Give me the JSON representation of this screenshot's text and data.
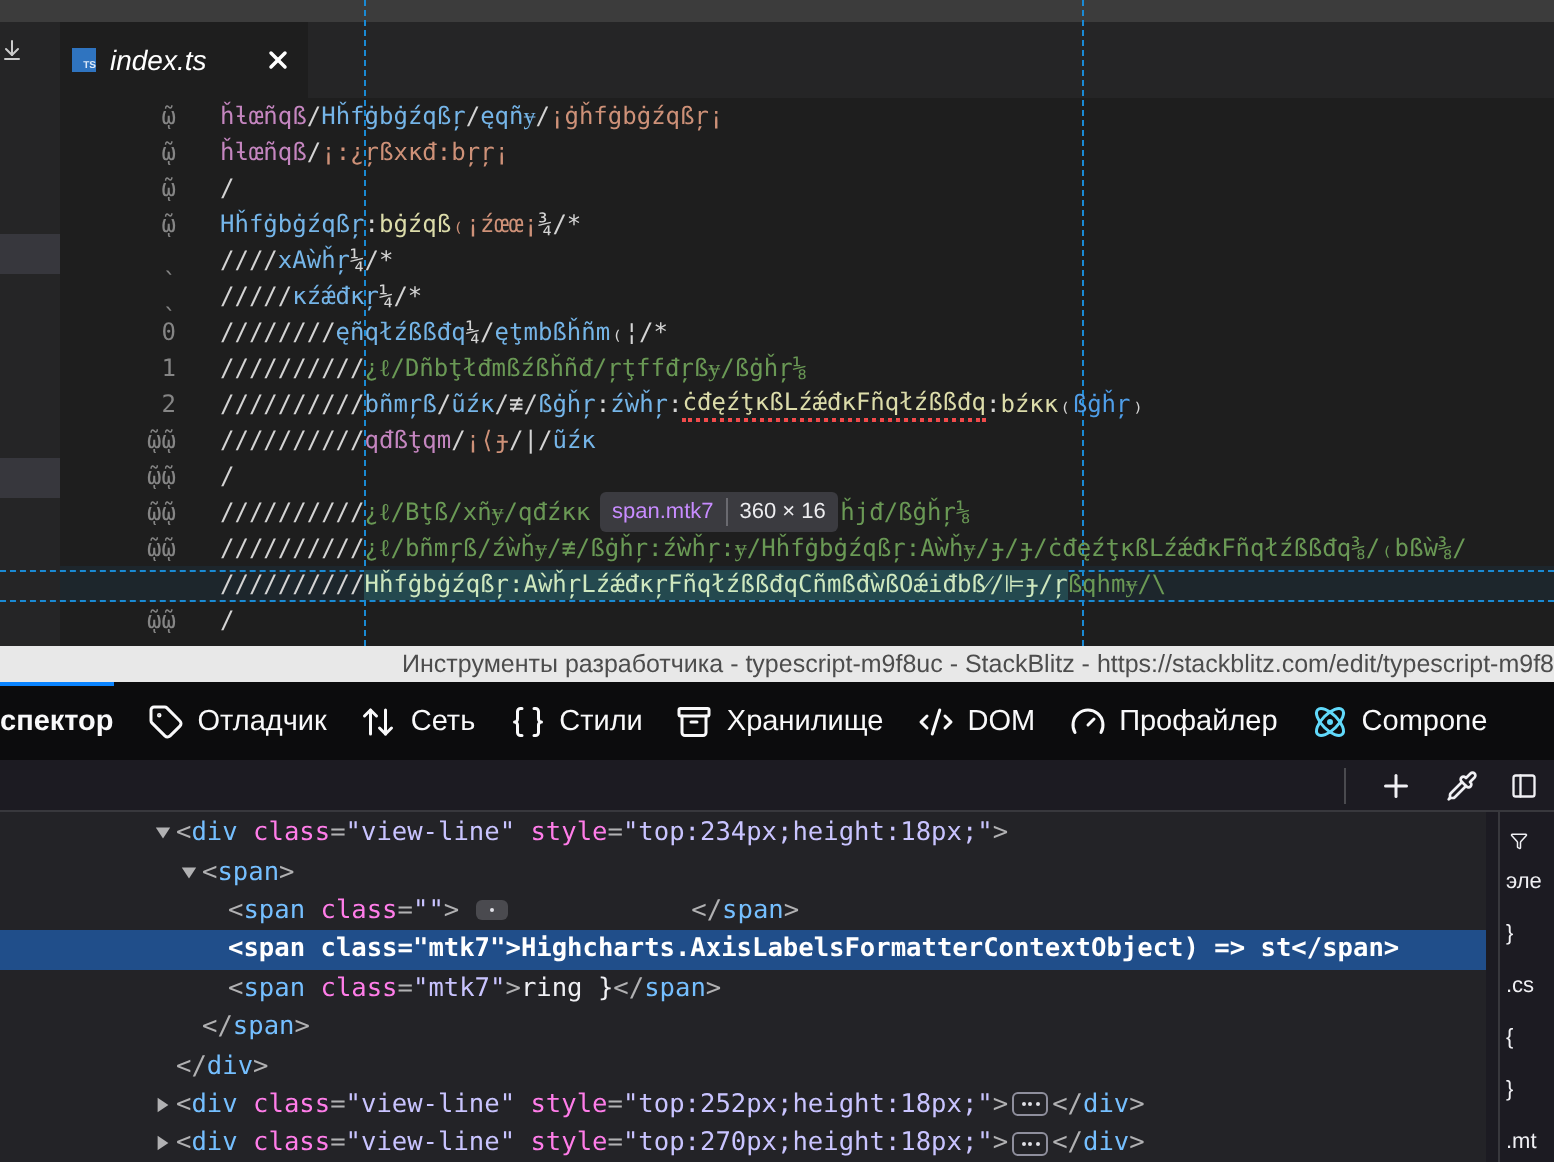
{
  "editor": {
    "tab": {
      "file_icon": "TS",
      "label": "index.ts",
      "selected": true
    },
    "lines": [
      {
        "gutter": "ῷ",
        "highlighted": false,
        "tokens": [
          {
            "text": "ȟƚœñqß",
            "color": "#c586c0"
          },
          {
            "text": "/",
            "color": "#d4d4d4"
          },
          {
            "text": "Hȟfġbġźqßŗ",
            "color": "#75b5e8"
          },
          {
            "text": "/",
            "color": "#d4d4d4"
          },
          {
            "text": "ęqñɏ",
            "color": "#75b5e8"
          },
          {
            "text": "/",
            "color": "#d4d4d4"
          },
          {
            "text": "¡ġȟfġbġźqßŗ¡",
            "color": "#ce9178"
          }
        ]
      },
      {
        "gutter": "ῷ",
        "highlighted": false,
        "tokens": [
          {
            "text": "ȟƚœñqß",
            "color": "#c586c0"
          },
          {
            "text": "/",
            "color": "#d4d4d4"
          },
          {
            "text": "¡:¿ŗßxκđ:bŗŗ¡",
            "color": "#ce9178"
          }
        ]
      },
      {
        "gutter": "ῷ",
        "highlighted": false,
        "tokens": [
          {
            "text": "/",
            "color": "#d4d4d4"
          }
        ]
      },
      {
        "gutter": "ῷ",
        "highlighted": false,
        "tokens": [
          {
            "text": "Hȟfġbġźqßŗ",
            "color": "#75b5e8"
          },
          {
            "text": ":",
            "color": "#d4d4d4"
          },
          {
            "text": "bġźqß",
            "color": "#dcdcaa"
          },
          {
            "text": "₍¡źœœ¡",
            "color": "#ce9178"
          },
          {
            "text": "¾/*",
            "color": "#d4d4d4"
          }
        ]
      },
      {
        "gutter": "ˎ",
        "highlighted": false,
        "tokens": [
          {
            "text": "////",
            "color": "#d4d4d4"
          },
          {
            "text": "xAẁȟŗ",
            "color": "#75b5e8"
          },
          {
            "text": "¼/*",
            "color": "#d4d4d4"
          }
        ]
      },
      {
        "gutter": "ˎ",
        "highlighted": false,
        "tokens": [
          {
            "text": "/////",
            "color": "#d4d4d4"
          },
          {
            "text": "κźǽđκŗ",
            "color": "#75b5e8"
          },
          {
            "text": "¼/*",
            "color": "#d4d4d4"
          }
        ]
      },
      {
        "gutter": "0",
        "highlighted": false,
        "tokens": [
          {
            "text": "////////",
            "color": "#d4d4d4"
          },
          {
            "text": "ęñqłźßßđq",
            "color": "#75b5e8"
          },
          {
            "text": "¼/",
            "color": "#d4d4d4"
          },
          {
            "text": "ęţmbßȟñm",
            "color": "#75b5e8"
          },
          {
            "text": "₍¦/*",
            "color": "#d4d4d4"
          }
        ]
      },
      {
        "gutter": "1",
        "highlighted": false,
        "tokens": [
          {
            "text": "//////////",
            "color": "#d4d4d4"
          },
          {
            "text": "¿ℓ/Dñbţłđmßźßȟñđ/ŗţffđŗßɏ/ßġȟŗ⅛",
            "color": "#6a9955"
          }
        ]
      },
      {
        "gutter": "2",
        "highlighted": false,
        "tokens": [
          {
            "text": "//////////",
            "color": "#d4d4d4"
          },
          {
            "text": "bñmŗß",
            "color": "#75b5e8"
          },
          {
            "text": "/",
            "color": "#d4d4d4"
          },
          {
            "text": "ũźκ",
            "color": "#75b5e8"
          },
          {
            "text": "/≢/",
            "color": "#d4d4d4"
          },
          {
            "text": "ßġȟŗ",
            "color": "#75b5e8"
          },
          {
            "text": ":",
            "color": "#d4d4d4"
          },
          {
            "text": "źẁȟŗ",
            "color": "#75b5e8"
          },
          {
            "text": ":",
            "color": "#d4d4d4"
          },
          {
            "text": "ċđęźţκßLźǽđκFñqłźßßđq",
            "color": "#dcdcaa",
            "error": true
          },
          {
            "text": ":",
            "color": "#d4d4d4"
          },
          {
            "text": "bźκκ",
            "color": "#dcdcaa"
          },
          {
            "text": "₍",
            "color": "#d4d4d4"
          },
          {
            "text": "ßġȟŗ",
            "color": "#4f9ee8"
          },
          {
            "text": "₎",
            "color": "#d4d4d4"
          }
        ]
      },
      {
        "gutter": "ῷῷ",
        "highlighted": false,
        "tokens": [
          {
            "text": "//////////",
            "color": "#d4d4d4"
          },
          {
            "text": "qđßţqm",
            "color": "#c586c0"
          },
          {
            "text": "/",
            "color": "#d4d4d4"
          },
          {
            "text": "¡⟨ɟ",
            "color": "#ce9178"
          },
          {
            "text": "/|/",
            "color": "#d4d4d4"
          },
          {
            "text": "ũźκ",
            "color": "#75b5e8"
          }
        ]
      },
      {
        "gutter": "ῷῷ",
        "highlighted": false,
        "tokens": [
          {
            "text": "/",
            "color": "#d4d4d4"
          }
        ]
      },
      {
        "gutter": "ῷῷ",
        "highlighted": false,
        "tokens": [
          {
            "text": "//////////",
            "color": "#d4d4d4"
          },
          {
            "text": "¿ℓ/Bţß/xñɏ/qđźκκ",
            "color": "#6a9955"
          },
          {
            "text": "ȟjđ/ßġȟŗ⅛",
            "color": "#6a9955",
            "after_tooltip": true
          }
        ]
      },
      {
        "gutter": "ῷῷ",
        "highlighted": false,
        "tokens": [
          {
            "text": "//////////",
            "color": "#d4d4d4"
          },
          {
            "text": "¿ℓ/bñmŗß/źẁȟɏ/≢/ßġȟŗ:źẁȟŗ:ɏ/Hȟfġbġźqßŗ:Aẁȟɏ/ɟ/ɟ/ċđęźţκßLźǽđκFñqłźßßđq⅜/₍bßẁ⅜/",
            "color": "#6a9955"
          }
        ]
      },
      {
        "highlighted": true,
        "tokens": [
          {
            "text": "//////////",
            "color": "#d4d4d4"
          },
          {
            "text": "Hȟfġbġźqßŗ:AẁȟŗLźǽđκŗFñqłźßßđqCñmßđẁßOǽiđbß⁄/⊫ɟ/ŗ",
            "highlight": true
          },
          {
            "text": "ßqhmɏ/\\",
            "color": "#6a9955"
          }
        ]
      },
      {
        "gutter": "ῷῷ",
        "highlighted": false,
        "tokens": [
          {
            "text": "/",
            "color": "#d4d4d4"
          }
        ]
      }
    ],
    "tooltip": {
      "selector": "span.mtk7",
      "size": "360 × 16"
    }
  },
  "window": {
    "title": "Инструменты разработчика - typescript-m9f8uc - StackBlitz - https://stackblitz.com/edit/typescript-m9f8"
  },
  "devtools_tabs": [
    {
      "label": "спектор",
      "kind": "inspector",
      "selected": true
    },
    {
      "label": "Отладчик",
      "kind": "debugger",
      "selected": false
    },
    {
      "label": "Сеть",
      "kind": "network",
      "selected": false
    },
    {
      "label": "Стили",
      "kind": "styles",
      "selected": false
    },
    {
      "label": "Хранилище",
      "kind": "storage",
      "selected": false
    },
    {
      "label": "DOM",
      "kind": "dom",
      "selected": false
    },
    {
      "label": "Профайлер",
      "kind": "profiler",
      "selected": false
    },
    {
      "label": "Compone",
      "kind": "components",
      "selected": false
    }
  ],
  "markup": [
    {
      "expanded": true,
      "selected": false,
      "tokens": [
        {
          "kind": "punct",
          "text": "<"
        },
        {
          "kind": "tag",
          "text": "div"
        },
        {
          "kind": "attr",
          "text": "class"
        },
        {
          "kind": "punct",
          "text": "="
        },
        {
          "kind": "value",
          "text": "\"view-line\""
        },
        {
          "kind": "attr",
          "text": "style"
        },
        {
          "kind": "punct",
          "text": "="
        },
        {
          "kind": "value",
          "text": "\"top:234px;height:18px;\""
        },
        {
          "kind": "punct",
          "text": ">"
        }
      ],
      "children": [
        {
          "expanded": true,
          "selected": false,
          "tokens": [
            {
              "kind": "punct",
              "text": "<"
            },
            {
              "kind": "tag",
              "text": "span"
            },
            {
              "kind": "punct",
              "text": ">"
            }
          ],
          "children": [
            {
              "selected": false,
              "tokens": [
                {
                  "kind": "punct",
                  "text": "<"
                },
                {
                  "kind": "tag",
                  "text": "span"
                },
                {
                  "kind": "attr",
                  "text": "class"
                },
                {
                  "kind": "punct",
                  "text": "="
                },
                {
                  "kind": "value",
                  "text": "\"\""
                },
                {
                  "kind": "punct",
                  "text": ">"
                },
                {
                  "kind": "whitespace"
                },
                {
                  "kind": "punct",
                  "text": "</"
                },
                {
                  "kind": "tag",
                  "text": "span"
                },
                {
                  "kind": "punct",
                  "text": ">"
                }
              ]
            },
            {
              "selected": true,
              "tokens": [
                {
                  "kind": "punct",
                  "text": "<"
                },
                {
                  "kind": "tag",
                  "text": "span"
                },
                {
                  "kind": "attr",
                  "text": "class"
                },
                {
                  "kind": "punct",
                  "text": "="
                },
                {
                  "kind": "value",
                  "text": "\"mtk7\""
                },
                {
                  "kind": "punct",
                  "text": ">"
                },
                {
                  "kind": "text",
                  "text": "Highcharts.AxisLabelsFormatterContextObject) => st"
                },
                {
                  "kind": "punct",
                  "text": "</"
                },
                {
                  "kind": "tag",
                  "text": "span"
                },
                {
                  "kind": "punct",
                  "text": ">"
                }
              ]
            },
            {
              "selected": false,
              "tokens": [
                {
                  "kind": "punct",
                  "text": "<"
                },
                {
                  "kind": "tag",
                  "text": "span"
                },
                {
                  "kind": "attr",
                  "text": "class"
                },
                {
                  "kind": "punct",
                  "text": "="
                },
                {
                  "kind": "value",
                  "text": "\"mtk7\""
                },
                {
                  "kind": "punct",
                  "text": ">"
                },
                {
                  "kind": "text",
                  "text": "ring }"
                },
                {
                  "kind": "punct",
                  "text": "</"
                },
                {
                  "kind": "tag",
                  "text": "span"
                },
                {
                  "kind": "punct",
                  "text": ">"
                }
              ]
            }
          ],
          "closing": [
            {
              "kind": "punct",
              "text": "</"
            },
            {
              "kind": "tag",
              "text": "span"
            },
            {
              "kind": "punct",
              "text": ">"
            }
          ]
        }
      ],
      "closing": [
        {
          "kind": "punct",
          "text": "</"
        },
        {
          "kind": "tag",
          "text": "div"
        },
        {
          "kind": "punct",
          "text": ">"
        }
      ]
    },
    {
      "expanded": false,
      "selected": false,
      "tokens": [
        {
          "kind": "punct",
          "text": "<"
        },
        {
          "kind": "tag",
          "text": "div"
        },
        {
          "kind": "attr",
          "text": "class"
        },
        {
          "kind": "punct",
          "text": "="
        },
        {
          "kind": "value",
          "text": "\"view-line\""
        },
        {
          "kind": "attr",
          "text": "style"
        },
        {
          "kind": "punct",
          "text": "="
        },
        {
          "kind": "value",
          "text": "\"top:252px;height:18px;\""
        },
        {
          "kind": "punct",
          "text": ">"
        },
        {
          "kind": "more"
        },
        {
          "kind": "punct",
          "text": "</"
        },
        {
          "kind": "tag",
          "text": "div"
        },
        {
          "kind": "punct",
          "text": ">"
        }
      ]
    },
    {
      "expanded": false,
      "selected": false,
      "tokens": [
        {
          "kind": "punct",
          "text": "<"
        },
        {
          "kind": "tag",
          "text": "div"
        },
        {
          "kind": "attr",
          "text": "class"
        },
        {
          "kind": "punct",
          "text": "="
        },
        {
          "kind": "value",
          "text": "\"view-line\""
        },
        {
          "kind": "attr",
          "text": "style"
        },
        {
          "kind": "punct",
          "text": "="
        },
        {
          "kind": "value",
          "text": "\"top:270px;height:18px;\""
        },
        {
          "kind": "punct",
          "text": ">"
        },
        {
          "kind": "more"
        },
        {
          "kind": "punct",
          "text": "</"
        },
        {
          "kind": "tag",
          "text": "div"
        },
        {
          "kind": "punct",
          "text": ">"
        }
      ]
    }
  ],
  "rules_panel": [
    "эле",
    "}",
    ".cs",
    "{",
    "}",
    ".mt"
  ]
}
